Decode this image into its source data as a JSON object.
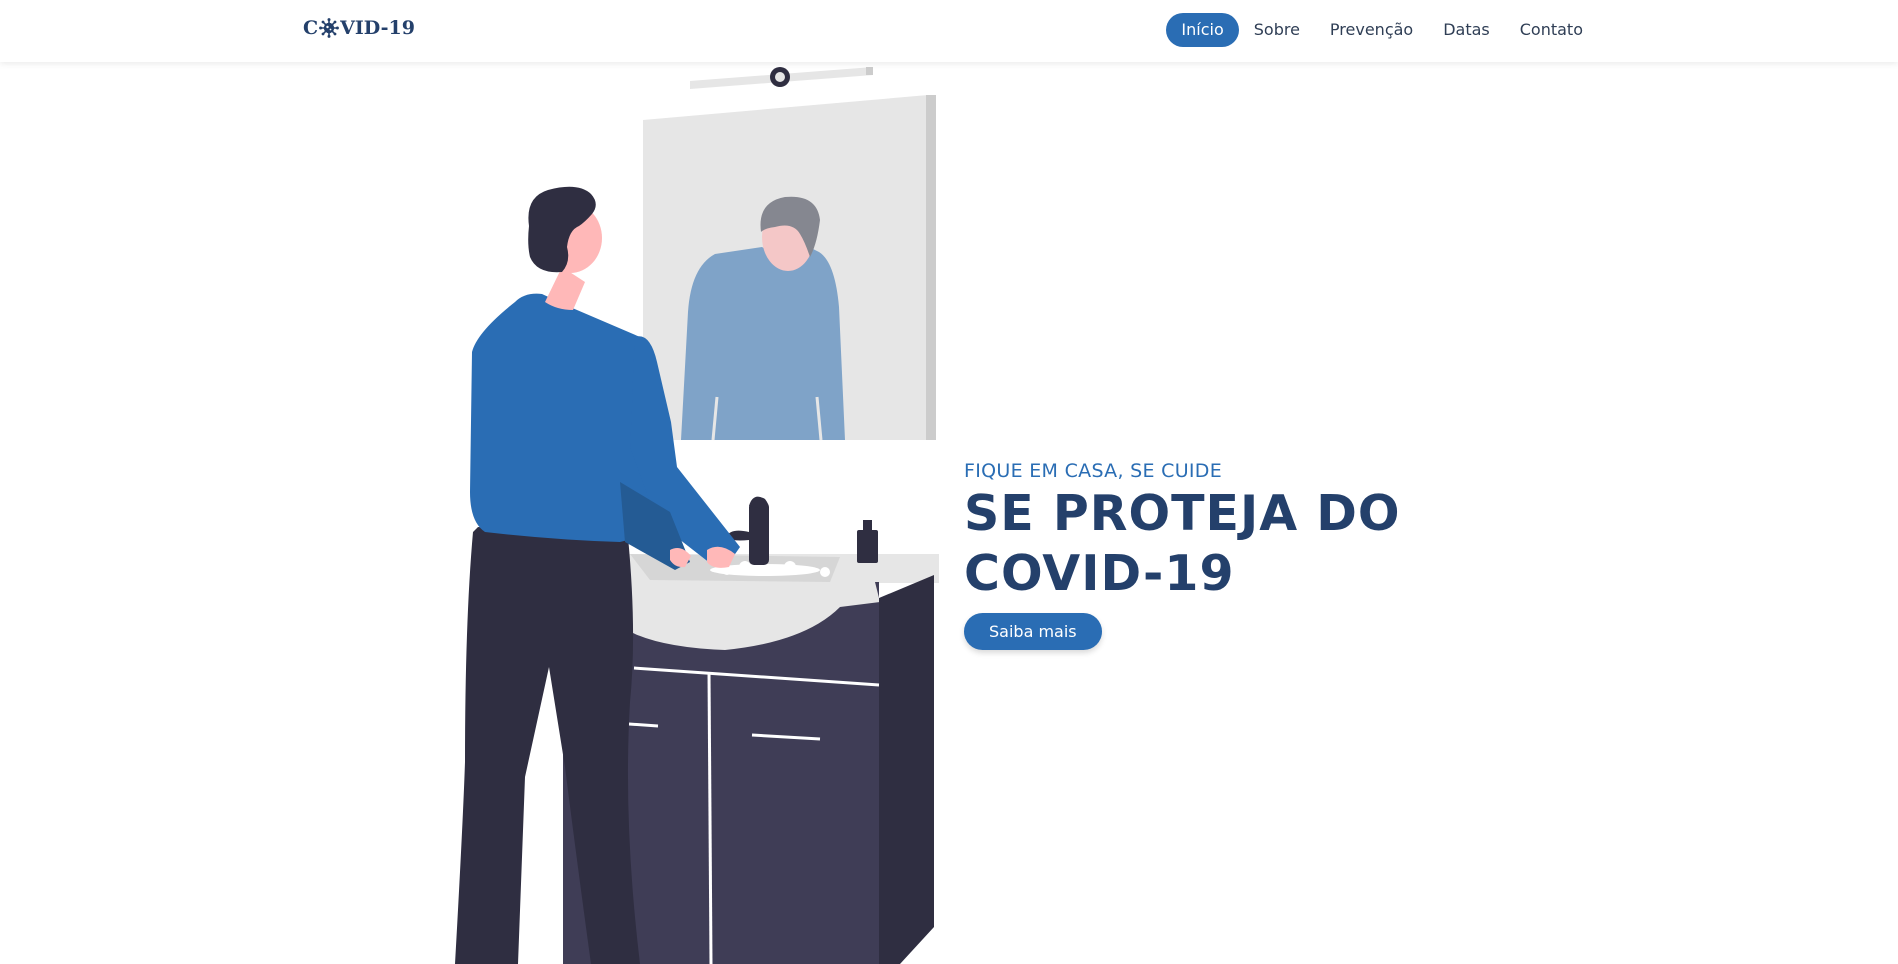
{
  "brand": {
    "prefix": "C",
    "suffix": "VID-19",
    "icon": "virus-icon"
  },
  "nav": {
    "items": [
      {
        "label": "Início",
        "active": true
      },
      {
        "label": "Sobre",
        "active": false
      },
      {
        "label": "Prevenção",
        "active": false
      },
      {
        "label": "Datas",
        "active": false
      },
      {
        "label": "Contato",
        "active": false
      }
    ]
  },
  "hero": {
    "subtitle": "FIQUE EM CASA, SE CUIDE",
    "title_line1": "SE PROTEJA DO",
    "title_line2": "COVID-19",
    "cta_label": "Saiba mais",
    "illustration": "man-washing-hands-illustration"
  },
  "colors": {
    "primary": "#2a6db4",
    "dark_blue": "#24406b",
    "cabinet": "#3f3d56",
    "dark": "#2f2e41",
    "skin": "#ffb8b8"
  }
}
